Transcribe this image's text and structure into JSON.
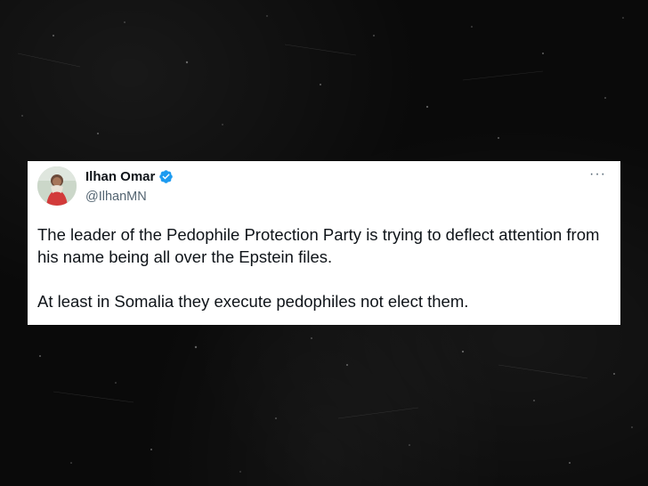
{
  "tweet": {
    "author_name": "Ilhan Omar",
    "author_handle": "@IlhanMN",
    "verified": true,
    "more_menu": "···",
    "paragraphs": [
      "The leader of the Pedophile Protection Party is trying to deflect attention from his name being all over the Epstein files.",
      "At least in Somalia they execute pedophiles not elect them."
    ]
  },
  "colors": {
    "background": "#0a0a0a",
    "card": "#ffffff",
    "text_primary": "#0f1419",
    "text_secondary": "#536471",
    "verified_blue": "#1d9bf0"
  }
}
